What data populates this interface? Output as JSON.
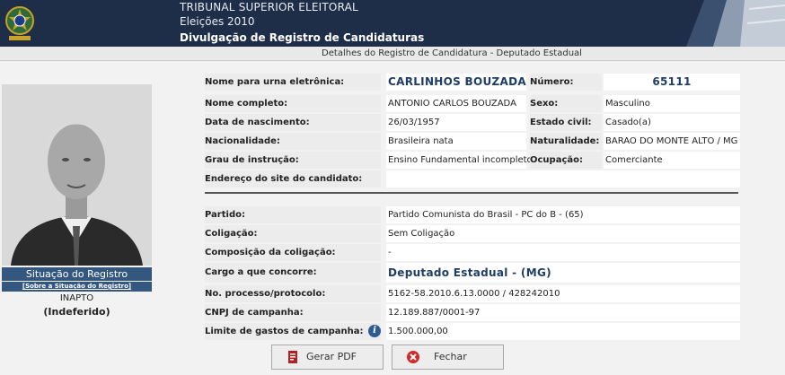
{
  "header": {
    "court": "TRIBUNAL SUPERIOR ELEITORAL",
    "election": "Eleições 2010",
    "title": "Divulgação de Registro de Candidaturas"
  },
  "subtitle": "Detalhes do Registro de Candidatura - Deputado Estadual",
  "situation": {
    "title": "Situação do Registro",
    "link": "[Sobre a Situação do Registro]",
    "status": "INAPTO",
    "detail": "(Indeferido)"
  },
  "fields": {
    "ballot_name_label": "Nome para urna eletrônica:",
    "ballot_name": "CARLINHOS BOUZADA",
    "number_label": "Número:",
    "number": "65111",
    "full_name_label": "Nome completo:",
    "full_name": "ANTONIO CARLOS BOUZADA",
    "sex_label": "Sexo:",
    "sex": "Masculino",
    "birth_label": "Data de nascimento:",
    "birth": "26/03/1957",
    "civil_label": "Estado civil:",
    "civil": "Casado(a)",
    "nationality_label": "Nacionalidade:",
    "nationality": "Brasileira nata",
    "birthplace_label": "Naturalidade:",
    "birthplace": "BARAO DO MONTE ALTO / MG",
    "education_label": "Grau de instrução:",
    "education": "Ensino Fundamental incompleto",
    "occupation_label": "Ocupação:",
    "occupation": "Comerciante",
    "site_label": "Endereço do site do candidato:",
    "site": "",
    "party_label": "Partido:",
    "party": "Partido Comunista do Brasil - PC do B - (65)",
    "coalition_label": "Coligação:",
    "coalition": "Sem Coligação",
    "coalition_comp_label": "Composição da coligação:",
    "coalition_comp": "-",
    "office_label": "Cargo a que concorre:",
    "office": "Deputado Estadual - (MG)",
    "process_label": "No. processo/protocolo:",
    "process": "5162-58.2010.6.13.0000 / 428242010",
    "cnpj_label": "CNPJ de campanha:",
    "cnpj": "12.189.887/0001-97",
    "limit_label": "Limite de gastos de campanha:",
    "limit": "1.500.000,00"
  },
  "buttons": {
    "pdf": "Gerar PDF",
    "close": "Fechar"
  },
  "icons": {
    "emblem": "brasil-emblem-icon",
    "info": "info-icon",
    "pdf": "pdf-icon",
    "close": "close-icon"
  },
  "colors": {
    "header_bg": "#1e2d48",
    "situation_bg": "#33577f",
    "accent_text": "#1f3d66"
  }
}
